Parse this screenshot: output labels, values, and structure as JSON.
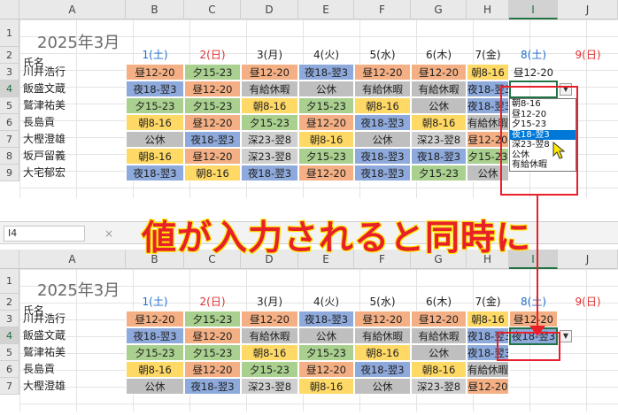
{
  "columns": [
    "A",
    "B",
    "C",
    "D",
    "E",
    "F",
    "G",
    "H",
    "I",
    "J"
  ],
  "top": {
    "row_numbers": [
      "1",
      "2",
      "3",
      "4",
      "5",
      "6",
      "7",
      "8",
      "9"
    ],
    "title": "2025年3月",
    "header_name": "氏名",
    "days": [
      {
        "label": "1(土)",
        "color": "#1f6fd0"
      },
      {
        "label": "2(日)",
        "color": "#e03030"
      },
      {
        "label": "3(月)",
        "color": "#222222"
      },
      {
        "label": "4(火)",
        "color": "#222222"
      },
      {
        "label": "5(水)",
        "color": "#222222"
      },
      {
        "label": "6(木)",
        "color": "#222222"
      },
      {
        "label": "7(金)",
        "color": "#222222"
      },
      {
        "label": "8(土)",
        "color": "#1f6fd0"
      },
      {
        "label": "9(日)",
        "color": "#e03030"
      }
    ],
    "rows": [
      {
        "name": "川井浩行",
        "shifts": [
          [
            "昼12-20",
            "o"
          ],
          [
            "夕15-23",
            "g"
          ],
          [
            "昼12-20",
            "o"
          ],
          [
            "夜18-翌3",
            "b"
          ],
          [
            "昼12-20",
            "o"
          ],
          [
            "昼12-20",
            "o"
          ],
          [
            "朝8-16",
            "y"
          ],
          [
            "昼12-20",
            "n"
          ]
        ]
      },
      {
        "name": "飯盛文蔵",
        "shifts": [
          [
            "夜18-翌3",
            "b"
          ],
          [
            "昼12-20",
            "o"
          ],
          [
            "有給休暇",
            "x"
          ],
          [
            "公休",
            "x"
          ],
          [
            "有給休暇",
            "x"
          ],
          [
            "有給休暇",
            "x"
          ],
          [
            "夜18-翌3",
            "b"
          ],
          [
            "",
            "n"
          ]
        ]
      },
      {
        "name": "鷲津祐美",
        "shifts": [
          [
            "夕15-23",
            "g"
          ],
          [
            "夕15-23",
            "g"
          ],
          [
            "朝8-16",
            "y"
          ],
          [
            "夕15-23",
            "g"
          ],
          [
            "朝8-16",
            "y"
          ],
          [
            "公休",
            "x"
          ],
          [
            "夜18-翌3",
            "b"
          ],
          [
            "",
            "n"
          ]
        ]
      },
      {
        "name": "長島貢",
        "shifts": [
          [
            "朝8-16",
            "y"
          ],
          [
            "昼12-20",
            "o"
          ],
          [
            "夕15-23",
            "g"
          ],
          [
            "昼12-20",
            "o"
          ],
          [
            "夜18-翌3",
            "b"
          ],
          [
            "朝8-16",
            "y"
          ],
          [
            "有給休暇",
            "x"
          ],
          [
            "",
            "n"
          ]
        ]
      },
      {
        "name": "大樫澄雄",
        "shifts": [
          [
            "公休",
            "x"
          ],
          [
            "夜18-翌3",
            "b"
          ],
          [
            "深23-翌8",
            "s"
          ],
          [
            "朝8-16",
            "y"
          ],
          [
            "公休",
            "x"
          ],
          [
            "深23-翌8",
            "s"
          ],
          [
            "昼12-20",
            "o"
          ],
          [
            "",
            "n"
          ]
        ]
      },
      {
        "name": "坂戸留義",
        "shifts": [
          [
            "朝8-16",
            "y"
          ],
          [
            "昼12-20",
            "o"
          ],
          [
            "深23-翌8",
            "s"
          ],
          [
            "夕15-23",
            "g"
          ],
          [
            "夜18-翌3",
            "b"
          ],
          [
            "夜18-翌3",
            "b"
          ],
          [
            "夕15-23",
            "g"
          ],
          [
            "",
            "n"
          ]
        ]
      },
      {
        "name": "大宅郁宏",
        "shifts": [
          [
            "夜18-翌3",
            "b"
          ],
          [
            "朝8-16",
            "y"
          ],
          [
            "夜18-翌3",
            "b"
          ],
          [
            "昼12-20",
            "o"
          ],
          [
            "夜18-翌3",
            "b"
          ],
          [
            "夕15-23",
            "g"
          ],
          [
            "公休",
            "x"
          ],
          [
            "",
            "n"
          ]
        ]
      }
    ],
    "dropdown_options": [
      "朝8-16",
      "昼12-20",
      "夕15-23",
      "夜18-翌3",
      "深23-翌8",
      "公休",
      "有給休暇"
    ],
    "dropdown_selected_index": 3
  },
  "formula_bar": {
    "cell_ref": "I4",
    "fx_mark": "×"
  },
  "banner_text": "値が入力されると同時に",
  "bottom": {
    "row_numbers": [
      "1",
      "2",
      "3",
      "4",
      "5",
      "6",
      "7"
    ],
    "title": "2025年3月",
    "header_name": "氏名",
    "rows": [
      {
        "name": "川井浩行",
        "shifts": [
          [
            "昼12-20",
            "o"
          ],
          [
            "夕15-23",
            "g"
          ],
          [
            "昼12-20",
            "o"
          ],
          [
            "夜18-翌3",
            "b"
          ],
          [
            "昼12-20",
            "o"
          ],
          [
            "昼12-20",
            "o"
          ],
          [
            "朝8-16",
            "y"
          ],
          [
            "昼12-20",
            "o"
          ]
        ]
      },
      {
        "name": "飯盛文蔵",
        "shifts": [
          [
            "夜18-翌3",
            "b"
          ],
          [
            "昼12-20",
            "o"
          ],
          [
            "有給休暇",
            "x"
          ],
          [
            "公休",
            "x"
          ],
          [
            "有給休暇",
            "x"
          ],
          [
            "有給休暇",
            "x"
          ],
          [
            "夜18-翌3",
            "b"
          ],
          [
            "夜18-翌3",
            "b"
          ]
        ]
      },
      {
        "name": "鷲津祐美",
        "shifts": [
          [
            "夕15-23",
            "g"
          ],
          [
            "夕15-23",
            "g"
          ],
          [
            "朝8-16",
            "y"
          ],
          [
            "夕15-23",
            "g"
          ],
          [
            "朝8-16",
            "y"
          ],
          [
            "公休",
            "x"
          ],
          [
            "夜18-翌3",
            "b"
          ],
          [
            "",
            "n"
          ]
        ]
      },
      {
        "name": "長島貢",
        "shifts": [
          [
            "朝8-16",
            "y"
          ],
          [
            "昼12-20",
            "o"
          ],
          [
            "夕15-23",
            "g"
          ],
          [
            "昼12-20",
            "o"
          ],
          [
            "夜18-翌3",
            "b"
          ],
          [
            "朝8-16",
            "y"
          ],
          [
            "有給休暇",
            "x"
          ],
          [
            "",
            "n"
          ]
        ]
      },
      {
        "name": "大樫澄雄",
        "shifts": [
          [
            "公休",
            "x"
          ],
          [
            "夜18-翌3",
            "b"
          ],
          [
            "深23-翌8",
            "s"
          ],
          [
            "朝8-16",
            "y"
          ],
          [
            "公休",
            "x"
          ],
          [
            "深23-翌8",
            "s"
          ],
          [
            "昼12-20",
            "o"
          ],
          [
            "",
            "n"
          ]
        ]
      }
    ]
  },
  "colors": {
    "highlight_red": "#e8202a",
    "selection_green": "#217346",
    "list_select_blue": "#0078d7"
  }
}
